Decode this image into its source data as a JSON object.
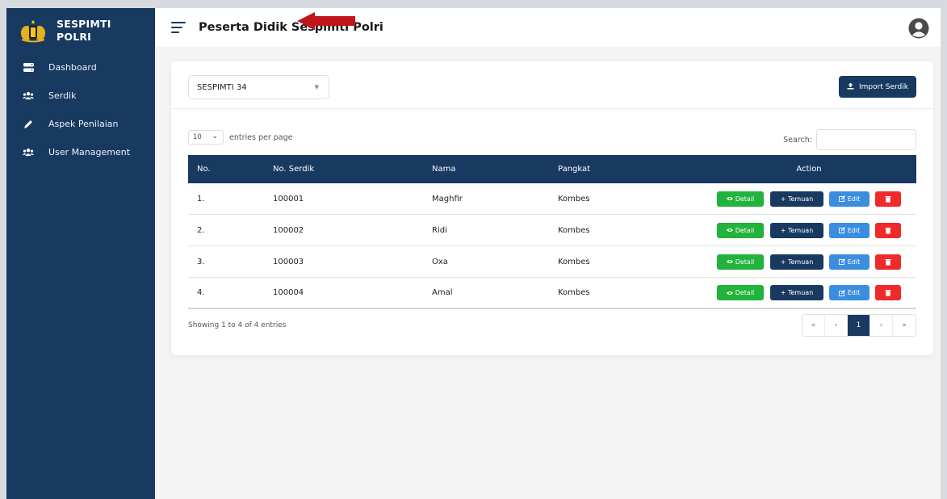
{
  "brand": {
    "title": "SESPIMTI\nPOLRI"
  },
  "sidebar": {
    "items": [
      {
        "label": "Dashboard",
        "icon": "server-icon"
      },
      {
        "label": "Serdik",
        "icon": "users-icon"
      },
      {
        "label": "Aspek Penilaian",
        "icon": "pen-icon"
      },
      {
        "label": "User Management",
        "icon": "users-icon"
      }
    ]
  },
  "header": {
    "title": "Peserta Didik Sespimti Polri"
  },
  "filter": {
    "selected": "SESPIMTI 34"
  },
  "toolbar": {
    "import_label": "Import Serdik"
  },
  "entries": {
    "value": "10",
    "label": "entries per page"
  },
  "search": {
    "label": "Search:",
    "value": ""
  },
  "table": {
    "columns": [
      "No.",
      "No. Serdik",
      "Nama",
      "Pangkat",
      "Action"
    ],
    "rows": [
      {
        "no": "1.",
        "serdik": "100001",
        "nama": "Maghfir",
        "pangkat": "Kombes"
      },
      {
        "no": "2.",
        "serdik": "100002",
        "nama": "Ridi",
        "pangkat": "Kombes"
      },
      {
        "no": "3.",
        "serdik": "100003",
        "nama": "Oxa",
        "pangkat": "Kombes"
      },
      {
        "no": "4.",
        "serdik": "100004",
        "nama": "Amal",
        "pangkat": "Kombes"
      }
    ],
    "actions": {
      "detail": "Detail",
      "temuan": "+ Temuan",
      "edit": "Edit"
    }
  },
  "footer": {
    "info": "Showing 1 to 4 of 4 entries"
  },
  "pagination": {
    "first": "«",
    "prev": "‹",
    "current": "1",
    "next": "›",
    "last": "»"
  },
  "colors": {
    "primary": "#183a61",
    "success": "#22b33c",
    "info": "#3b8de0",
    "danger": "#ef2a2a",
    "annotation": "#c0161b"
  }
}
